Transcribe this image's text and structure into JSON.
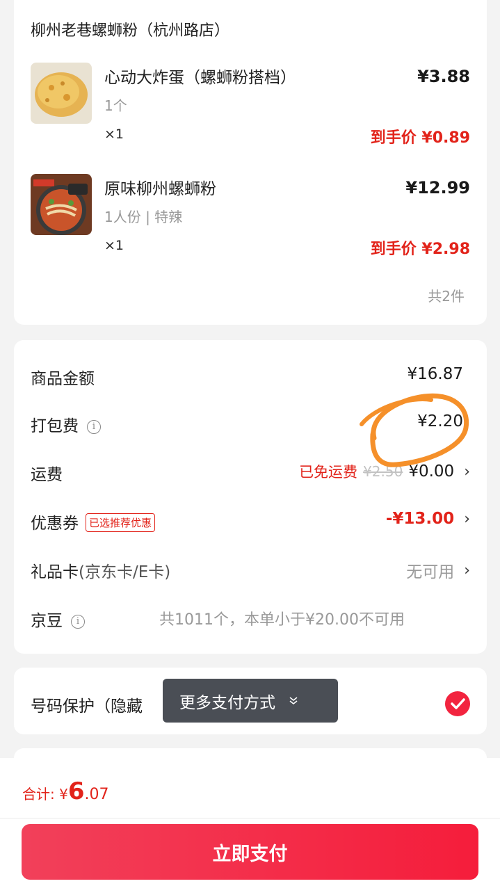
{
  "shop": {
    "name": "柳州老巷螺蛳粉（杭州路店）",
    "items": [
      {
        "name": "心动大炸蛋（螺蛳粉搭档）",
        "spec": "1个",
        "qty": "×1",
        "price": "¥3.88",
        "final_price": "到手价 ¥0.89",
        "thumb": "fried-egg-image"
      },
      {
        "name": "原味柳州螺蛳粉",
        "spec": "1人份 | 特辣",
        "qty": "×1",
        "price": "¥12.99",
        "final_price": "到手价 ¥2.98",
        "thumb": "river-snail-noodle-image"
      }
    ],
    "count": "共2件"
  },
  "fees": {
    "goods_amount": {
      "label": "商品金额",
      "value": "¥16.87"
    },
    "packing": {
      "label": "打包费",
      "value": "¥2.20"
    },
    "shipping": {
      "label": "运费",
      "free_text": "已免运费",
      "original": "¥2.50",
      "value": "¥0.00"
    },
    "coupon": {
      "label": "优惠券",
      "tag": "已选推荐优惠",
      "value": "-¥13.00"
    },
    "gift_card": {
      "label": "礼品卡",
      "sub": "(京东卡/E卡)",
      "value": "无可用"
    },
    "jd_bean": {
      "label": "京豆",
      "hint": "共1011个，本单小于¥20.00不可用"
    }
  },
  "protect": {
    "label": "号码保护（隐藏"
  },
  "popover": {
    "label": "更多支付方式"
  },
  "bottom": {
    "total_label": "合计: ¥",
    "total_int": "6",
    "total_dec": ".07",
    "pay_label": "立即支付"
  },
  "colors": {
    "accent": "#e2231a",
    "button": "#f51d3b",
    "annotation": "#f5902a"
  }
}
